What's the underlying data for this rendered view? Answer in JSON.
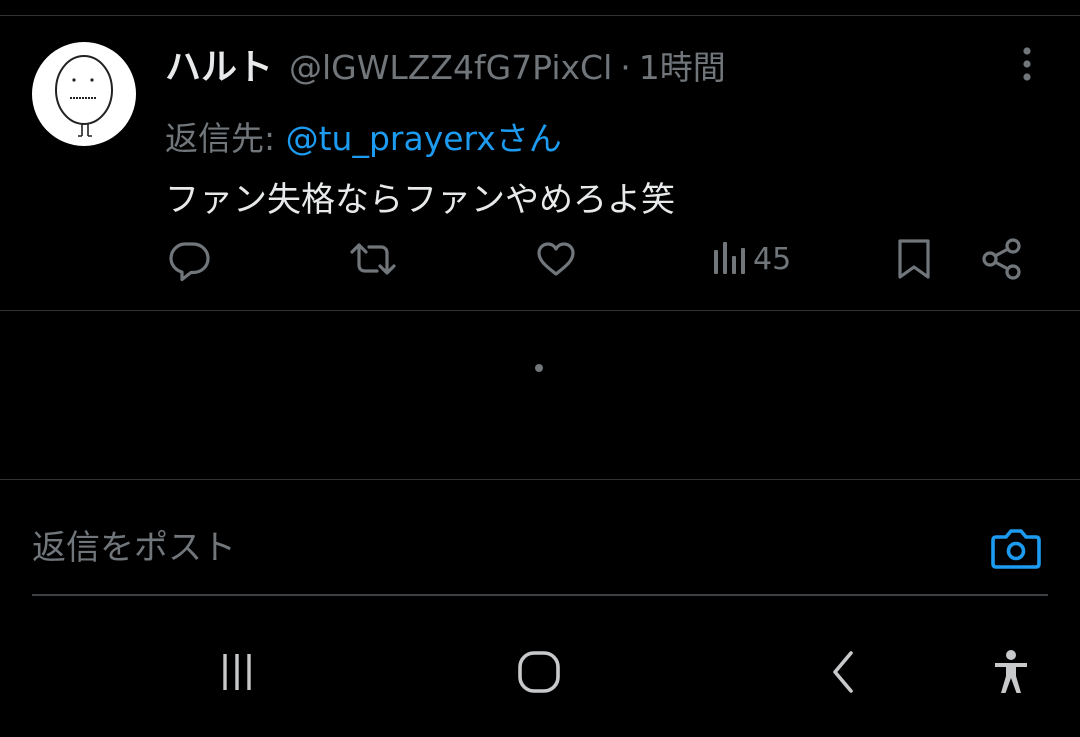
{
  "tweet": {
    "display_name": "ハルト",
    "handle": "@lGWLZZ4fG7PixCl",
    "separator": "·",
    "time": "1時間",
    "reply_prefix": "返信先: ",
    "reply_mention": "@tu_prayerxさん",
    "text": "ファン失格ならファンやめろよ笑",
    "views": "45"
  },
  "composer": {
    "placeholder": "返信をポスト"
  },
  "colors": {
    "background": "#000000",
    "primary_text": "#e7e9ea",
    "secondary_text": "#71767b",
    "accent": "#1d9bf0",
    "divider": "#2f3336"
  },
  "icons": {
    "more": "more-vertical-icon",
    "reply": "reply-icon",
    "retweet": "retweet-icon",
    "like": "heart-icon",
    "views": "views-icon",
    "bookmark": "bookmark-icon",
    "share": "share-icon",
    "camera": "camera-icon",
    "nav_recents": "recents-icon",
    "nav_home": "home-icon",
    "nav_back": "back-icon",
    "nav_accessibility": "accessibility-icon"
  }
}
